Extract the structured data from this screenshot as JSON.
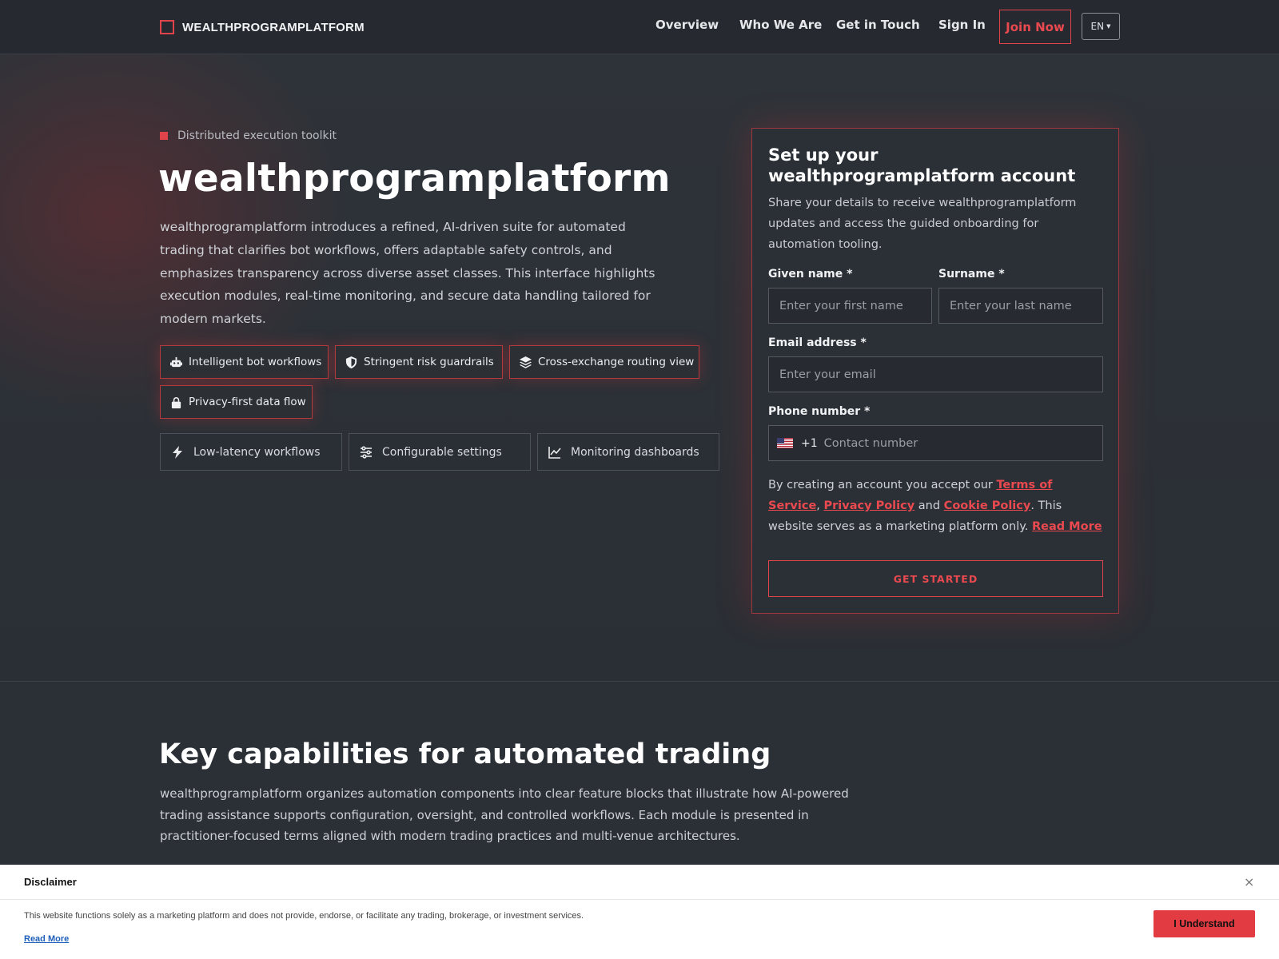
{
  "header": {
    "brand": "WEALTHPROGRAMPLATFORM",
    "nav": [
      "Overview",
      "Who We Are",
      "Get in Touch",
      "Sign In"
    ],
    "join": "Join Now",
    "lang": "EN"
  },
  "hero": {
    "eyebrow": "Distributed execution toolkit",
    "title": "wealthprogramplatform",
    "description": "wealthprogramplatform introduces a refined, AI-driven suite for automated trading that clarifies bot workflows, offers adaptable safety controls, and emphasizes transparency across diverse asset classes. This interface highlights execution modules, real-time monitoring, and secure data handling tailored for modern markets.",
    "pills": [
      {
        "icon": "robot-icon",
        "label": "Intelligent bot workflows"
      },
      {
        "icon": "shield-icon",
        "label": "Stringent risk guardrails"
      },
      {
        "icon": "layers-icon",
        "label": "Cross-exchange routing view"
      },
      {
        "icon": "lock-icon",
        "label": "Privacy-first data flow"
      }
    ],
    "chips": [
      {
        "icon": "bolt-icon",
        "label": "Low-latency workflows"
      },
      {
        "icon": "sliders-icon",
        "label": "Configurable settings"
      },
      {
        "icon": "chart-line-icon",
        "label": "Monitoring dashboards"
      }
    ]
  },
  "form": {
    "title": "Set up your wealthprogramplatform account",
    "subtitle": "Share your details to receive wealthprogramplatform updates and access the guided onboarding for automation tooling.",
    "first_label": "Given name *",
    "first_placeholder": "Enter your first name",
    "last_label": "Surname *",
    "last_placeholder": "Enter your last name",
    "email_label": "Email address *",
    "email_placeholder": "Enter your email",
    "phone_label": "Phone number *",
    "dial_code": "+1",
    "phone_placeholder": "Contact number",
    "terms_pre": "By creating an account you accept our ",
    "terms_link": "Terms of Service",
    "terms_comma": ",",
    "privacy_link": "Privacy Policy",
    "terms_and": " and ",
    "cookie_link": "Cookie Policy",
    "terms_post": ". This website serves as a marketing platform only. ",
    "read_more": "Read More",
    "submit": "GET STARTED"
  },
  "capabilities": {
    "title": "Key capabilities for automated trading",
    "description": "wealthprogramplatform organizes automation components into clear feature blocks that illustrate how AI-powered trading assistance supports configuration, oversight, and controlled workflows. Each module is presented in practitioner-focused terms aligned with modern trading practices and multi-venue architectures."
  },
  "disclaimer": {
    "title": "Disclaimer",
    "close": "×",
    "text": "This website functions solely as a marketing platform and does not provide, endorse, or facilitate any trading, brokerage, or investment services.",
    "read_more": "Read More",
    "button": "I Understand"
  },
  "colors": {
    "accent": "#e0444a",
    "background": "#2b3037",
    "header": "#262a30"
  }
}
